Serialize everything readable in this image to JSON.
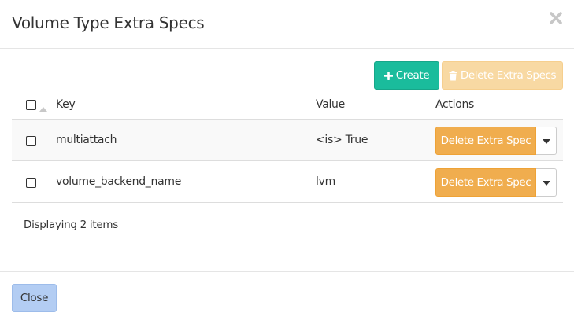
{
  "modal": {
    "title": "Volume Type Extra Specs",
    "close_icon": "close-icon"
  },
  "toolbar": {
    "create_label": "Create",
    "create_icon": "plus-icon",
    "delete_all_label": "Delete Extra Specs",
    "delete_all_icon": "trash-icon",
    "create_color": "#1abc9c",
    "delete_all_color": "#f8d9a3"
  },
  "table": {
    "columns": [
      "Key",
      "Value",
      "Actions"
    ],
    "rows": [
      {
        "key": "multiattach",
        "value": "<is> True",
        "action_label": "Delete Extra Spec"
      },
      {
        "key": "volume_backend_name",
        "value": "lvm",
        "action_label": "Delete Extra Spec"
      }
    ],
    "action_color": "#f0ad4e"
  },
  "footer": {
    "count_text": "Displaying 2 items",
    "close_label": "Close"
  }
}
